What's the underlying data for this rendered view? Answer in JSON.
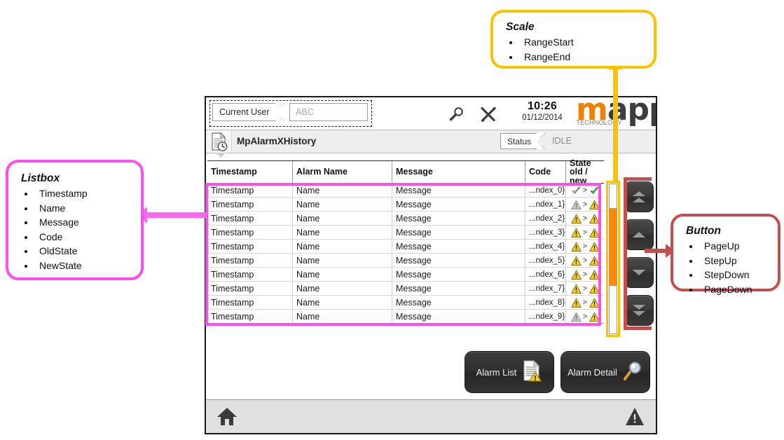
{
  "hmi": {
    "topbar": {
      "current_user_label": "Current User",
      "current_user_value": "ABC",
      "time": "10:26",
      "date": "01/12/2014",
      "logo_m": "m",
      "logo_app": "app",
      "logo_tech": "TECHNOLOGY",
      "search_icon": "search-icon",
      "tools_icon": "tools-icon"
    },
    "titlebar": {
      "page_title": "MpAlarmXHistory",
      "status_label": "Status",
      "status_value": "IDLE",
      "page_icon": "document-clock-icon"
    },
    "table": {
      "columns": [
        {
          "key": "timestamp",
          "label": "Timestamp",
          "label2": ""
        },
        {
          "key": "name",
          "label": "Alarm Name",
          "label2": ""
        },
        {
          "key": "message",
          "label": "Message",
          "label2": ""
        },
        {
          "key": "code",
          "label": "Code",
          "label2": ""
        },
        {
          "key": "state",
          "label": "State",
          "label2": "old / new"
        }
      ],
      "rows": [
        {
          "timestamp": "Timestamp",
          "name": "Name",
          "message": "Message",
          "code": "...ndex_0}",
          "old_state": "check-gray",
          "new_state": "check-green",
          "separator": ">"
        },
        {
          "timestamp": "Timestamp",
          "name": "Name",
          "message": "Message",
          "code": "...ndex_1}",
          "old_state": "warning-gray",
          "new_state": "warning-yellow",
          "separator": ">"
        },
        {
          "timestamp": "Timestamp",
          "name": "Name",
          "message": "Message",
          "code": "...ndex_2}",
          "old_state": "warning-yellow",
          "new_state": "warning-yellow",
          "separator": ">"
        },
        {
          "timestamp": "Timestamp",
          "name": "Name",
          "message": "Message",
          "code": "...ndex_3}",
          "old_state": "warning-yellow",
          "new_state": "warning-yellow",
          "separator": ">"
        },
        {
          "timestamp": "Timestamp",
          "name": "Name",
          "message": "Message",
          "code": "...ndex_4}",
          "old_state": "warning-yellow",
          "new_state": "warning-yellow",
          "separator": ">"
        },
        {
          "timestamp": "Timestamp",
          "name": "Name",
          "message": "Message",
          "code": "...ndex_5}",
          "old_state": "warning-yellow",
          "new_state": "warning-yellow",
          "separator": ">"
        },
        {
          "timestamp": "Timestamp",
          "name": "Name",
          "message": "Message",
          "code": "...ndex_6}",
          "old_state": "warning-yellow",
          "new_state": "warning-yellow",
          "separator": ">"
        },
        {
          "timestamp": "Timestamp",
          "name": "Name",
          "message": "Message",
          "code": "...ndex_7}",
          "old_state": "warning-yellow",
          "new_state": "warning-yellow",
          "separator": ">"
        },
        {
          "timestamp": "Timestamp",
          "name": "Name",
          "message": "Message",
          "code": "...ndex_8}",
          "old_state": "warning-yellow",
          "new_state": "warning-yellow",
          "separator": ">"
        },
        {
          "timestamp": "Timestamp",
          "name": "Name",
          "message": "Message",
          "code": "...ndex_9}",
          "old_state": "warning-gray",
          "new_state": "warning-yellow",
          "separator": ">"
        }
      ]
    },
    "scale": {
      "fill_color": "#ff8c00",
      "fill_top_percent": 16,
      "fill_height_percent": 52
    },
    "nav_buttons": [
      {
        "name": "page-up",
        "icon": "double-chevron-up-icon"
      },
      {
        "name": "step-up",
        "icon": "chevron-up-icon"
      },
      {
        "name": "step-down",
        "icon": "chevron-down-icon"
      },
      {
        "name": "page-down",
        "icon": "double-chevron-down-icon"
      }
    ],
    "actions": {
      "alarm_list": "Alarm List",
      "alarm_list_icon": "document-warning-icon",
      "alarm_detail": "Alarm Detail",
      "alarm_detail_icon": "magnifier-icon"
    },
    "footer": {
      "home_icon": "home-icon",
      "alarm_icon": "warning-triangle-icon"
    }
  },
  "callouts": {
    "listbox": {
      "title": "Listbox",
      "color": "#ff4df0",
      "items": [
        "Timestamp",
        "Name",
        "Message",
        "Code",
        "OldState",
        "NewState"
      ]
    },
    "scale": {
      "title": "Scale",
      "color": "#ffc000",
      "items": [
        "RangeStart",
        "RangeEnd"
      ]
    },
    "button": {
      "title": "Button",
      "color": "#c0504d",
      "items": [
        "PageUp",
        "StepUp",
        "StepDown",
        "PageDown"
      ]
    }
  }
}
